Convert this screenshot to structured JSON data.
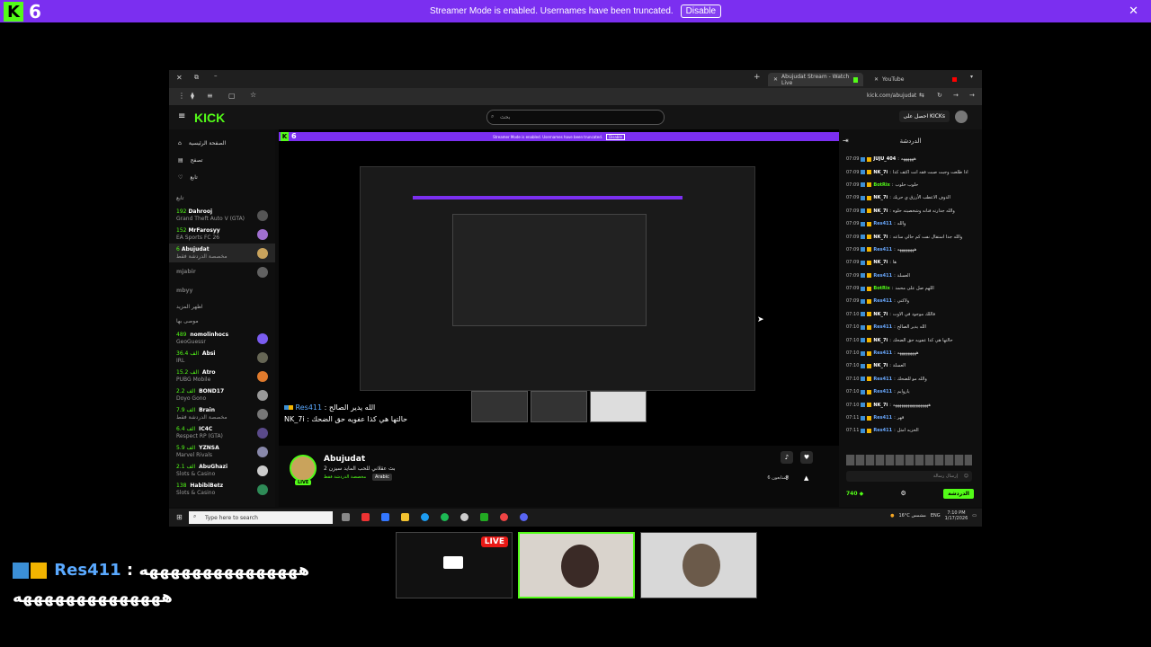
{
  "top_banner": {
    "viewer_count": "6",
    "message": "Streamer Mode is enabled. Usernames have been truncated.",
    "disable_label": "Disable"
  },
  "browser": {
    "tabs": [
      "Abujudat Stream - Watch Live",
      "YouTube"
    ],
    "url": "kick.com/abujudat"
  },
  "site": {
    "logo": "KICK",
    "search_placeholder": "بحث",
    "kicks_label": "احصل على KICKs",
    "nav": [
      "الصفحة الرئيسية",
      "تصفح",
      "تابع"
    ],
    "following_heading": "تابع",
    "show_more": "اظهر المزيد",
    "recommended_heading": "موصى بها",
    "channels": [
      {
        "count": "192",
        "name": "Dahrooj",
        "game": "Grand Theft Auto V (GTA)"
      },
      {
        "count": "152",
        "name": "MrFarosyy",
        "game": "EA Sports FC 26"
      },
      {
        "count": "6",
        "name": "Abujudat",
        "game": "مخصصة الدردشة فقط"
      },
      {
        "count": "",
        "name": "mjabir",
        "game": ""
      },
      {
        "count": "",
        "name": "mbyy",
        "game": ""
      }
    ],
    "recommended": [
      {
        "count": "489",
        "name": "nomolinhocs",
        "game": "GeoGuessr"
      },
      {
        "count": "36.4 الف",
        "name": "Absi",
        "game": "IRL"
      },
      {
        "count": "15.2 الف",
        "name": "Atro",
        "game": "PUBG Mobile"
      },
      {
        "count": "2.2 الف",
        "name": "BOND17",
        "game": "Doyo Gono"
      },
      {
        "count": "7.9 الف",
        "name": "Brain",
        "game": "مخصصة الدردشة فقط"
      },
      {
        "count": "6.4 الف",
        "name": "IC4C",
        "game": "Respect RP (GTA)"
      },
      {
        "count": "5.9 الف",
        "name": "YZNSA",
        "game": "Marvel Rivals"
      },
      {
        "count": "2.1 الف",
        "name": "AbuGhazi",
        "game": "Slots & Casino"
      },
      {
        "count": "138",
        "name": "HabibiBetz",
        "game": "Slots & Casino"
      }
    ]
  },
  "stream": {
    "mini_viewers": "6",
    "overlay_line1_user": "Res411",
    "overlay_line1_text": "الله يدير الصالح",
    "overlay_line2_user": "NK_7i",
    "overlay_line2_text": "حالتها هي كذا عفويه حق الضحك"
  },
  "channel": {
    "name": "Abujudat",
    "title": "بث عقلاني للحب المايد سيزن 2",
    "category": "مخصصة الدردشة فقط",
    "language": "Arabic",
    "live": "LIVE",
    "followers": "6 المتابعون"
  },
  "chat": {
    "header": "الدردشة",
    "messages": [
      {
        "time": "07:09",
        "user": "JUJU_404",
        "text": "ههههههه",
        "color": "white"
      },
      {
        "time": "07:09",
        "user": "NK_7i",
        "text": "اذا طلعت وجبت صبت فقه انت اكثف كذا",
        "color": "white"
      },
      {
        "time": "07:09",
        "user": "BotRix",
        "text": "حلوب حلوب",
        "color": "green"
      },
      {
        "time": "07:09",
        "user": "NK_7i",
        "text": "الدوف الاعطب الأرزق ي حريك",
        "color": "white"
      },
      {
        "time": "07:09",
        "user": "NK_7i",
        "text": "والله جدارته فنانه وشخصيته حلوه",
        "color": "white"
      },
      {
        "time": "07:09",
        "user": "Res411",
        "text": "والله",
        "color": "blue"
      },
      {
        "time": "07:09",
        "user": "NK_7i",
        "text": "والله جدا استقال نفت كم حالي ساعه",
        "color": "white"
      },
      {
        "time": "07:09",
        "user": "Res411",
        "text": "ههههههههه",
        "color": "blue"
      },
      {
        "time": "07:09",
        "user": "NK_7i",
        "text": "ها",
        "color": "white"
      },
      {
        "time": "07:09",
        "user": "Res411",
        "text": "العسلة",
        "color": "blue"
      },
      {
        "time": "07:09",
        "user": "BotRix",
        "text": "اللهم صل على محمد",
        "color": "green"
      },
      {
        "time": "07:09",
        "user": "Res411",
        "text": "ولاكني",
        "color": "blue"
      },
      {
        "time": "07:10",
        "user": "NK_7i",
        "text": "فاللك موجود في الاوت",
        "color": "white"
      },
      {
        "time": "07:10",
        "user": "Res411",
        "text": "الله يدير الصالح",
        "color": "blue"
      },
      {
        "time": "07:10",
        "user": "NK_7i",
        "text": "حالتها هي كذا عفويه حق الضحك",
        "color": "white"
      },
      {
        "time": "07:10",
        "user": "Res411",
        "text": "هههههههههه",
        "color": "blue"
      },
      {
        "time": "07:10",
        "user": "NK_7i",
        "text": "العسلة",
        "color": "white"
      },
      {
        "time": "07:10",
        "user": "Res411",
        "text": "والله مو للضحك",
        "color": "blue"
      },
      {
        "time": "07:10",
        "user": "Res411",
        "text": "ياروايم",
        "color": "blue"
      },
      {
        "time": "07:10",
        "user": "NK_7i",
        "text": "هههههههههههههههههه",
        "color": "white"
      },
      {
        "time": "07:11",
        "user": "Res411",
        "text": "قهر",
        "color": "blue"
      },
      {
        "time": "07:11",
        "user": "Res411",
        "text": "الحزبه امثل",
        "color": "blue"
      }
    ],
    "input_placeholder": "إرسال رسالة",
    "send_label": "الدردشة",
    "points": "740"
  },
  "taskbar": {
    "search_placeholder": "Type here to search",
    "weather": "16°C مشمس",
    "lang": "ENG",
    "time": "7:10 PM",
    "date": "1/17/2026"
  },
  "bottom_overlay": {
    "user": "Res411",
    "line1": "هههههههههههههههه",
    "line2": "ههههههههههههههه",
    "live_label": "LIVE"
  }
}
